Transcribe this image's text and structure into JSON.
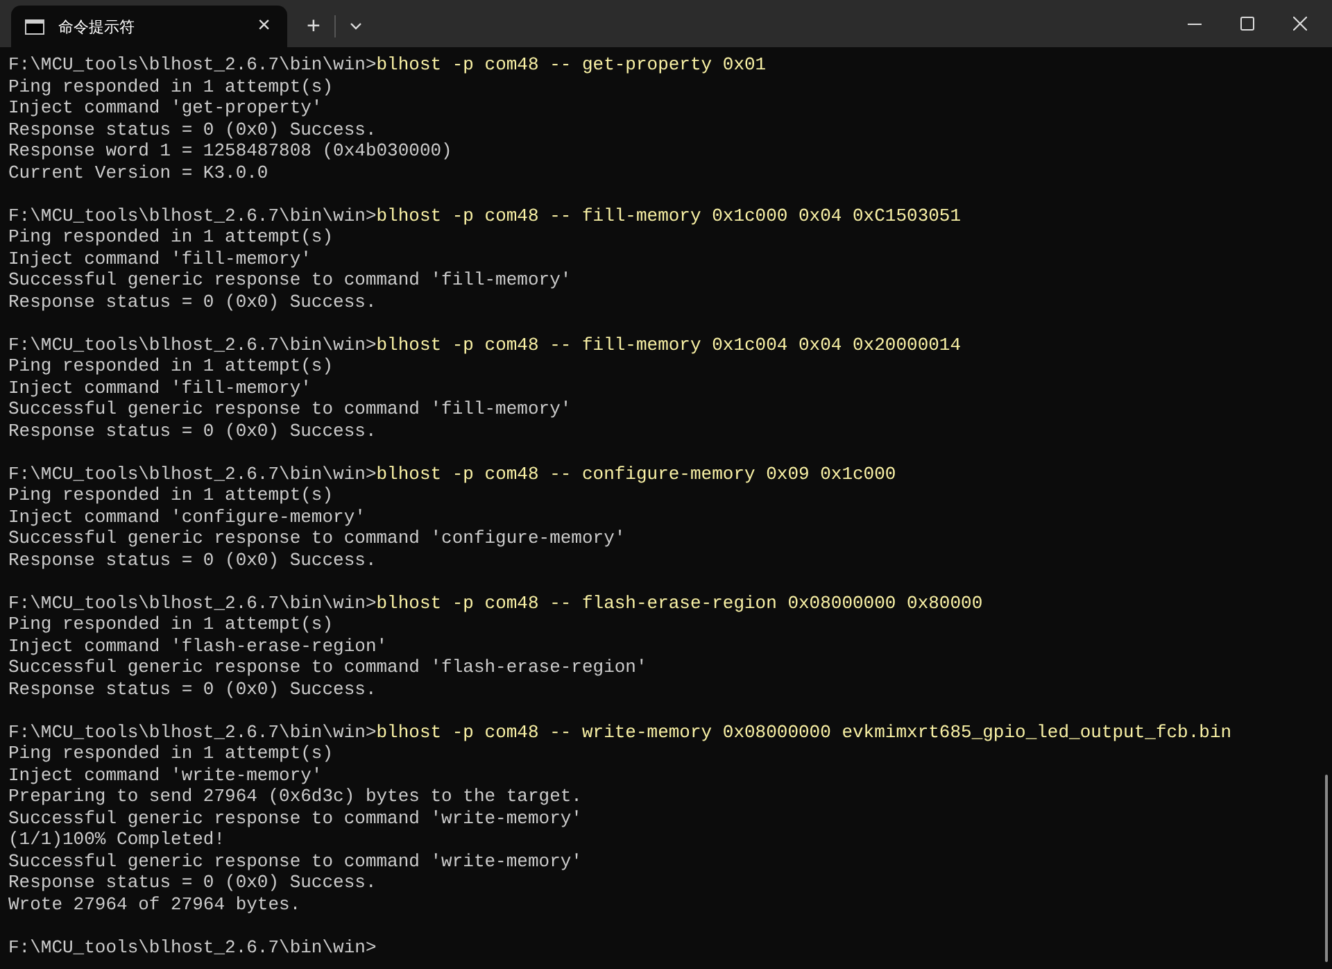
{
  "tab": {
    "title": "命令提示符",
    "close": "×",
    "new_tab": "+"
  },
  "lines": [
    {
      "kind": "prompt",
      "path": "F:\\MCU_tools\\blhost_2.6.7\\bin\\win>",
      "command": "blhost -p com48 -- get-property 0x01"
    },
    {
      "kind": "output",
      "text": "Ping responded in 1 attempt(s)"
    },
    {
      "kind": "output",
      "text": "Inject command 'get-property'"
    },
    {
      "kind": "output",
      "text": "Response status = 0 (0x0) Success."
    },
    {
      "kind": "output",
      "text": "Response word 1 = 1258487808 (0x4b030000)"
    },
    {
      "kind": "output",
      "text": "Current Version = K3.0.0"
    },
    {
      "kind": "blank"
    },
    {
      "kind": "prompt",
      "path": "F:\\MCU_tools\\blhost_2.6.7\\bin\\win>",
      "command": "blhost -p com48 -- fill-memory 0x1c000 0x04 0xC1503051"
    },
    {
      "kind": "output",
      "text": "Ping responded in 1 attempt(s)"
    },
    {
      "kind": "output",
      "text": "Inject command 'fill-memory'"
    },
    {
      "kind": "output",
      "text": "Successful generic response to command 'fill-memory'"
    },
    {
      "kind": "output",
      "text": "Response status = 0 (0x0) Success."
    },
    {
      "kind": "blank"
    },
    {
      "kind": "prompt",
      "path": "F:\\MCU_tools\\blhost_2.6.7\\bin\\win>",
      "command": "blhost -p com48 -- fill-memory 0x1c004 0x04 0x20000014"
    },
    {
      "kind": "output",
      "text": "Ping responded in 1 attempt(s)"
    },
    {
      "kind": "output",
      "text": "Inject command 'fill-memory'"
    },
    {
      "kind": "output",
      "text": "Successful generic response to command 'fill-memory'"
    },
    {
      "kind": "output",
      "text": "Response status = 0 (0x0) Success."
    },
    {
      "kind": "blank"
    },
    {
      "kind": "prompt",
      "path": "F:\\MCU_tools\\blhost_2.6.7\\bin\\win>",
      "command": "blhost -p com48 -- configure-memory 0x09 0x1c000"
    },
    {
      "kind": "output",
      "text": "Ping responded in 1 attempt(s)"
    },
    {
      "kind": "output",
      "text": "Inject command 'configure-memory'"
    },
    {
      "kind": "output",
      "text": "Successful generic response to command 'configure-memory'"
    },
    {
      "kind": "output",
      "text": "Response status = 0 (0x0) Success."
    },
    {
      "kind": "blank"
    },
    {
      "kind": "prompt",
      "path": "F:\\MCU_tools\\blhost_2.6.7\\bin\\win>",
      "command": "blhost -p com48 -- flash-erase-region 0x08000000 0x80000"
    },
    {
      "kind": "output",
      "text": "Ping responded in 1 attempt(s)"
    },
    {
      "kind": "output",
      "text": "Inject command 'flash-erase-region'"
    },
    {
      "kind": "output",
      "text": "Successful generic response to command 'flash-erase-region'"
    },
    {
      "kind": "output",
      "text": "Response status = 0 (0x0) Success."
    },
    {
      "kind": "blank"
    },
    {
      "kind": "prompt",
      "path": "F:\\MCU_tools\\blhost_2.6.7\\bin\\win>",
      "command": "blhost -p com48 -- write-memory 0x08000000 evkmimxrt685_gpio_led_output_fcb.bin"
    },
    {
      "kind": "output",
      "text": "Ping responded in 1 attempt(s)"
    },
    {
      "kind": "output",
      "text": "Inject command 'write-memory'"
    },
    {
      "kind": "output",
      "text": "Preparing to send 27964 (0x6d3c) bytes to the target."
    },
    {
      "kind": "output",
      "text": "Successful generic response to command 'write-memory'"
    },
    {
      "kind": "output",
      "text": "(1/1)100% Completed!"
    },
    {
      "kind": "output",
      "text": "Successful generic response to command 'write-memory'"
    },
    {
      "kind": "output",
      "text": "Response status = 0 (0x0) Success."
    },
    {
      "kind": "output",
      "text": "Wrote 27964 of 27964 bytes."
    },
    {
      "kind": "blank"
    },
    {
      "kind": "prompt",
      "path": "F:\\MCU_tools\\blhost_2.6.7\\bin\\win>"
    }
  ]
}
